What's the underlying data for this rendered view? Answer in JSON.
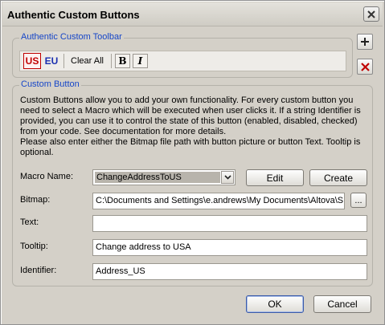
{
  "window": {
    "title": "Authentic Custom Buttons"
  },
  "toolbar_group": {
    "legend": "Authentic Custom Toolbar",
    "buttons": {
      "us": "US",
      "eu": "EU",
      "clear_all": "Clear All",
      "bold": "B",
      "italic": "I"
    },
    "add_button_icon": "plus-icon",
    "delete_button_icon": "delete-x-icon"
  },
  "custom_button_group": {
    "legend": "Custom Button",
    "description": [
      "Custom Buttons allow you to add your own functionality. For every custom button you need to select a Macro which will be executed when user clicks it. If a string Identifier is provided, you can use it to control the state of this button (enabled, disabled, checked) from your code. See documentation for more details.",
      "Please also enter either the Bitmap file path with button picture or button Text. Tooltip is optional."
    ],
    "macro_name": {
      "label": "Macro Name:",
      "value": "ChangeAddressToUS"
    },
    "edit_button": "Edit",
    "create_button": "Create",
    "bitmap": {
      "label": "Bitmap:",
      "value": "C:\\Documents and Settings\\e.andrews\\My Documents\\Altova\\S"
    },
    "browse_button": "...",
    "text": {
      "label": "Text:",
      "value": ""
    },
    "tooltip": {
      "label": "Tooltip:",
      "value": "Change address to USA"
    },
    "identifier": {
      "label": "Identifier:",
      "value": "Address_US"
    }
  },
  "footer": {
    "ok": "OK",
    "cancel": "Cancel"
  },
  "colors": {
    "legend_text": "#1646c8",
    "us_red": "#c00000",
    "eu_blue": "#1a2fb0",
    "dialog_background": "#d4d0c8"
  }
}
